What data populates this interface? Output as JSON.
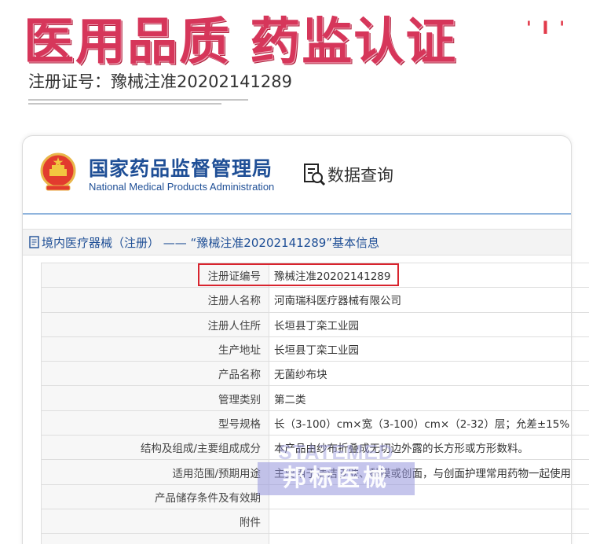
{
  "banner": {
    "headline": "医用品质 药监认证",
    "corner_mark": "' I '",
    "registration_line": "注册证号：豫械注准20202141289"
  },
  "agency": {
    "name_cn": "国家药品监督管理局",
    "name_en": "National Medical Products Administration",
    "query_label": "数据查询",
    "emblem_icon": "national-emblem-icon",
    "query_icon": "document-search-icon"
  },
  "section": {
    "title": "境内医疗器械（注册） —— “豫械注准20202141289”基本信息",
    "icon": "document-icon"
  },
  "info_rows": [
    {
      "label": "注册证编号",
      "value": "豫械注准20202141289"
    },
    {
      "label": "注册人名称",
      "value": "河南瑞科医疗器械有限公司"
    },
    {
      "label": "注册人住所",
      "value": "长垣县丁栾工业园"
    },
    {
      "label": "生产地址",
      "value": "长垣县丁栾工业园"
    },
    {
      "label": "产品名称",
      "value": "无菌纱布块"
    },
    {
      "label": "管理类别",
      "value": "第二类"
    },
    {
      "label": "型号规格",
      "value": "长（3-100）cm×宽（3-100）cm×（2-32）层；允差±15%"
    },
    {
      "label": "结构及组成/主要组成成分",
      "value": "本产品由纱布折叠成无切边外露的长方形或方形数料。"
    },
    {
      "label": "适用范围/预期用途",
      "value": "主要用于清洁皮肤、黏膜或创面，与创面护理常用药物一起使用"
    },
    {
      "label": "产品储存条件及有效期",
      "value": ""
    },
    {
      "label": "附件",
      "value": ""
    },
    {
      "label": "",
      "value": ""
    }
  ],
  "watermark": {
    "brand_en": "STATEMED",
    "brand_cn": "邦标医械"
  },
  "colors": {
    "headline": "#d6365a",
    "agency_blue": "#1f4f96",
    "highlight_red": "#d8242e",
    "watermark": "#9696dc"
  }
}
